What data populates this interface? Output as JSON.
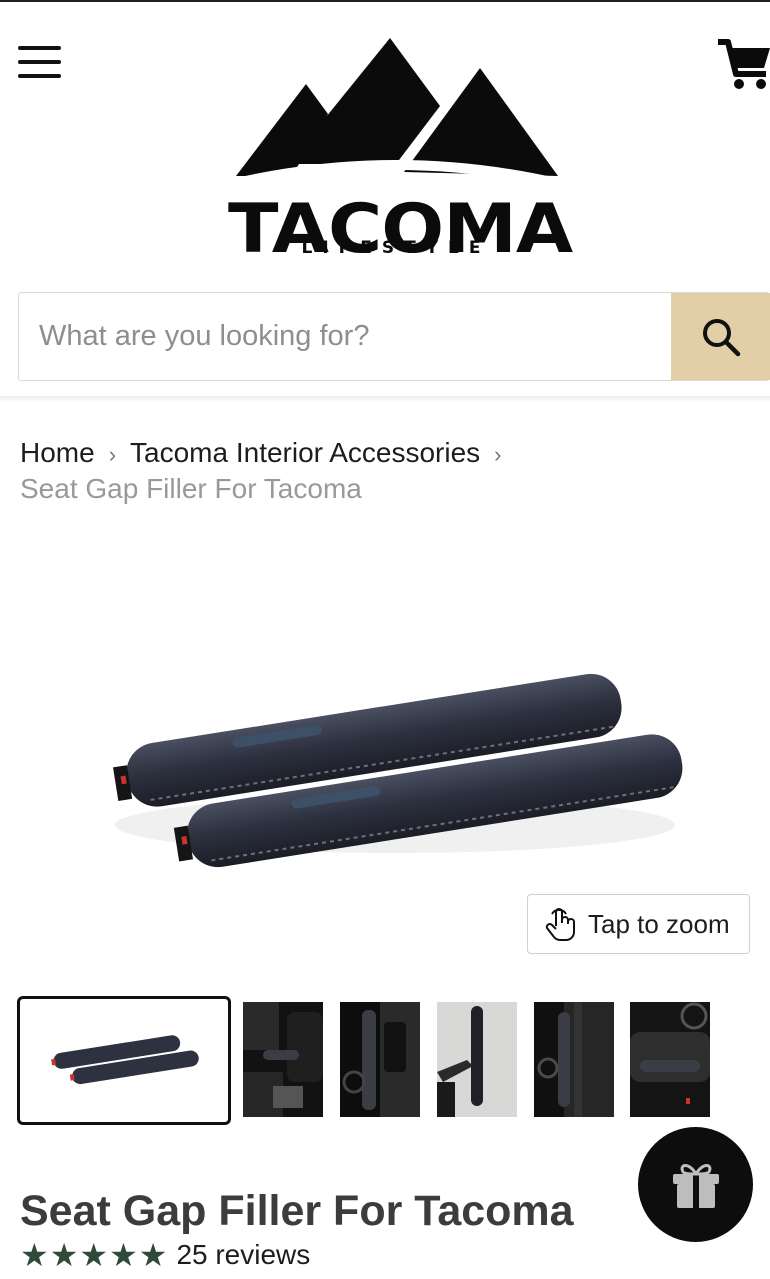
{
  "brand": {
    "name": "TACOMA",
    "tagline": "LIFESTYLE"
  },
  "header": {
    "menu_icon": "hamburger-menu-icon",
    "cart_icon": "shopping-cart-icon"
  },
  "search": {
    "placeholder": "What are you looking for?",
    "value": "",
    "button_icon": "search-icon",
    "button_color": "#e2cfa8"
  },
  "breadcrumb": {
    "items": [
      "Home",
      "Tacoma Interior Accessories"
    ],
    "current": "Seat Gap Filler For Tacoma",
    "separator": "›"
  },
  "gallery": {
    "zoom_label": "Tap to zoom",
    "zoom_icon": "tap-hand-icon",
    "thumbnail_count": 6,
    "active_index": 0
  },
  "product": {
    "title": "Seat Gap Filler For Tacoma",
    "rating": 5,
    "stars": "★★★★★",
    "reviews": "25 reviews",
    "star_color": "#2f4a3a"
  },
  "floating": {
    "gift_icon": "gift-icon"
  }
}
